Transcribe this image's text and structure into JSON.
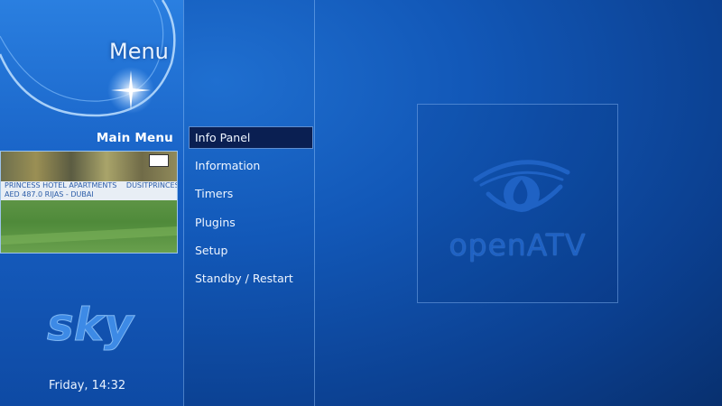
{
  "header": {
    "title": "Menu"
  },
  "sidebar": {
    "section_label": "Main Menu",
    "preview": {
      "ad_boards": [
        "PRINCESS  HOTEL APARTMENTS",
        "DUSITPRINCESS",
        "AED 487.0  RIJAS - DUBAI"
      ]
    },
    "channel_logo": "sky",
    "clock": "Friday,  14:32"
  },
  "menu": {
    "items": [
      {
        "label": "Info Panel",
        "selected": true
      },
      {
        "label": "Information",
        "selected": false
      },
      {
        "label": "Timers",
        "selected": false
      },
      {
        "label": "Plugins",
        "selected": false
      },
      {
        "label": "Setup",
        "selected": false
      },
      {
        "label": "Standby / Restart",
        "selected": false
      }
    ]
  },
  "branding": {
    "logo_text": "openATV",
    "logo_icon": "eye-icon"
  },
  "colors": {
    "background": "#1258b8",
    "selection_bg": "#0a1f52",
    "logo": "#1f62c4"
  }
}
